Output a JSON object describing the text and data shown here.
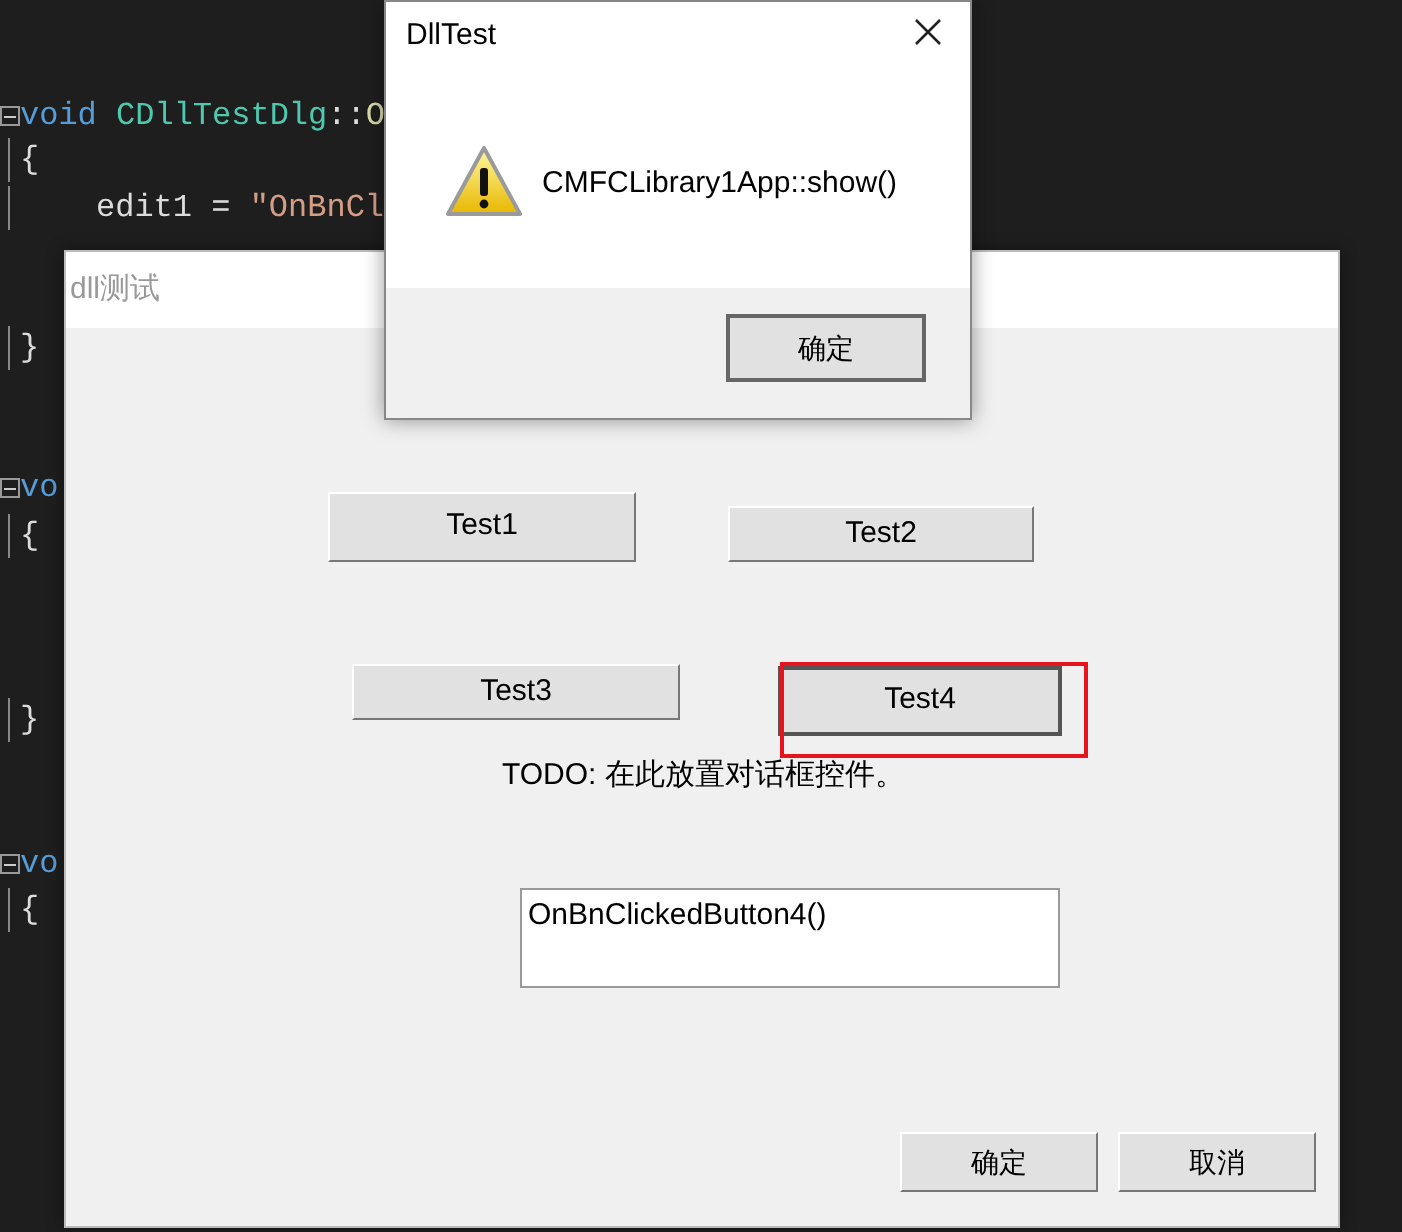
{
  "code_lines": [
    {
      "foldable": true,
      "segments": [
        {
          "kind": "keyword",
          "text": "void"
        },
        {
          "kind": "type",
          "text": " CDllTestDlg"
        },
        {
          "kind": "plain",
          "text": "::"
        },
        {
          "kind": "function",
          "text": "O"
        }
      ]
    },
    {
      "foldable": false,
      "segments": [
        {
          "kind": "plain",
          "text": "{"
        }
      ]
    },
    {
      "foldable": false,
      "segments": [
        {
          "kind": "plain",
          "text": "edit1 = "
        },
        {
          "kind": "string",
          "text": "\"OnBnCl"
        }
      ]
    },
    {
      "foldable": false,
      "segments": [
        {
          "kind": "plain",
          "text": "}"
        }
      ]
    },
    {
      "foldable": true,
      "segments": [
        {
          "kind": "keyword",
          "text": "vo"
        }
      ]
    },
    {
      "foldable": false,
      "segments": [
        {
          "kind": "plain",
          "text": "{"
        }
      ]
    },
    {
      "foldable": false,
      "segments": [
        {
          "kind": "plain",
          "text": "}"
        }
      ]
    },
    {
      "foldable": true,
      "segments": [
        {
          "kind": "keyword",
          "text": "vo"
        }
      ]
    },
    {
      "foldable": false,
      "segments": [
        {
          "kind": "plain",
          "text": "{"
        }
      ]
    }
  ],
  "main_dialog": {
    "title": "dll测试",
    "buttons": [
      {
        "label": "Test1",
        "focused": false
      },
      {
        "label": "Test2",
        "focused": false
      },
      {
        "label": "Test3",
        "focused": false
      },
      {
        "label": "Test4",
        "focused": true
      }
    ],
    "label": "TODO: 在此放置对话框控件。",
    "edit_value": "OnBnClickedButton4()",
    "footer_buttons": [
      "确定",
      "取消"
    ]
  },
  "message_box": {
    "title": "DllTest",
    "message": "CMFCLibrary1App::show()",
    "button": "确定"
  }
}
